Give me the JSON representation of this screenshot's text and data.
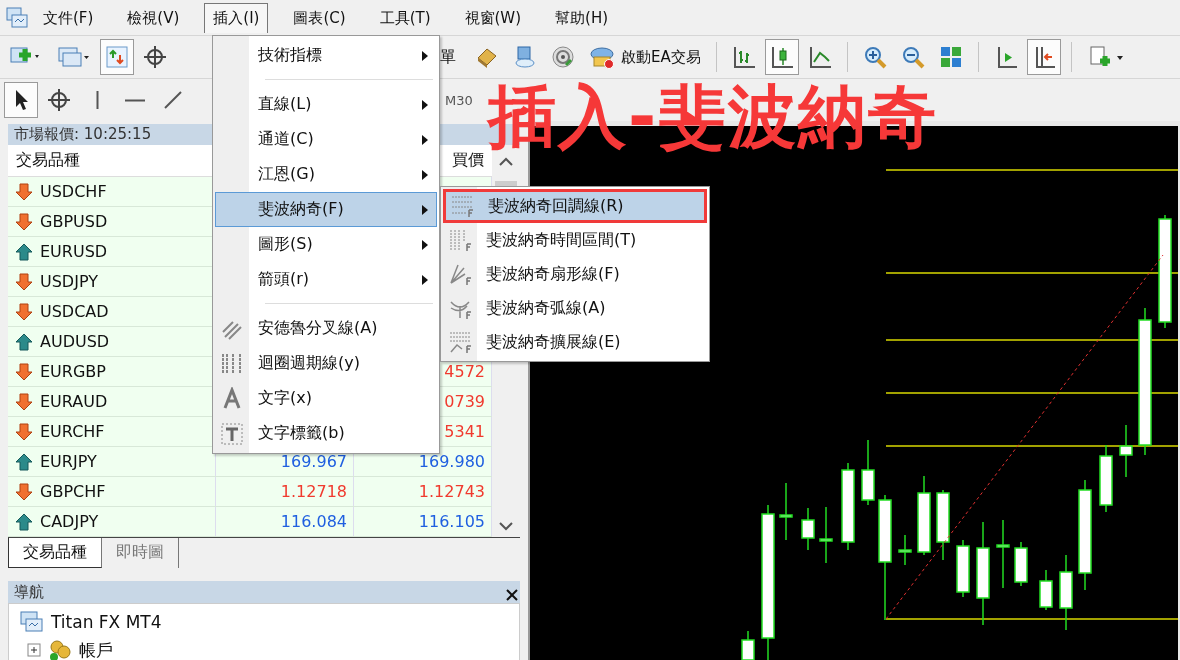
{
  "menu_bar": [
    {
      "label": "文件(F)",
      "selected": false
    },
    {
      "label": "檢視(V)",
      "selected": false
    },
    {
      "label": "插入(I)",
      "selected": true
    },
    {
      "label": "圖表(C)",
      "selected": false
    },
    {
      "label": "工具(T)",
      "selected": false
    },
    {
      "label": "視窗(W)",
      "selected": false
    },
    {
      "label": "幫助(H)",
      "selected": false
    }
  ],
  "toolbar": {
    "left": [
      {
        "kind": "new-chart"
      },
      {
        "kind": "profiles"
      },
      {
        "kind": "market-watch",
        "selected": true
      },
      {
        "kind": "crosshair"
      }
    ],
    "right": [
      {
        "kind": "text",
        "label": "單"
      },
      {
        "kind": "book"
      },
      {
        "kind": "terminal"
      },
      {
        "kind": "signals"
      },
      {
        "kind": "ea",
        "label": "啟動EA交易"
      },
      {
        "kind": "sep"
      },
      {
        "kind": "bars"
      },
      {
        "kind": "candles",
        "selected": true
      },
      {
        "kind": "line"
      },
      {
        "kind": "sep"
      },
      {
        "kind": "zoom-in"
      },
      {
        "kind": "zoom-out"
      },
      {
        "kind": "tile"
      },
      {
        "kind": "sep"
      },
      {
        "kind": "shift"
      },
      {
        "kind": "autoscroll",
        "selected": true
      },
      {
        "kind": "sep"
      },
      {
        "kind": "template"
      }
    ]
  },
  "drawing_toolbar": {
    "tools": [
      {
        "kind": "cursor",
        "selected": true
      },
      {
        "kind": "crosshair"
      },
      {
        "kind": "vline"
      },
      {
        "kind": "hline"
      },
      {
        "kind": "trendline"
      }
    ],
    "timeframes": [
      {
        "label": "M30",
        "selected": false
      }
    ]
  },
  "annotation": "插入-斐波納奇",
  "market_watch": {
    "title": "市場報價: 10:25:15",
    "columns": [
      "交易品種",
      "買價"
    ],
    "rows": [
      {
        "symbol": "USDCHF",
        "rising": false
      },
      {
        "symbol": "GBPUSD",
        "rising": false
      },
      {
        "symbol": "EURUSD",
        "rising": true
      },
      {
        "symbol": "USDJPY",
        "rising": false
      },
      {
        "symbol": "USDCAD",
        "rising": false
      },
      {
        "symbol": "AUDUSD",
        "rising": true
      },
      {
        "symbol": "EURGBP",
        "rising": false,
        "ask": "4572",
        "color": "#f03a2e"
      },
      {
        "symbol": "EURAUD",
        "rising": false,
        "ask": "0739",
        "color": "#f03a2e"
      },
      {
        "symbol": "EURCHF",
        "rising": false,
        "ask": "5341",
        "color": "#f03a2e"
      },
      {
        "symbol": "EURJPY",
        "rising": true,
        "bid": "169.967",
        "ask": "169.980",
        "color": "#1f5fe0"
      },
      {
        "symbol": "GBPCHF",
        "rising": false,
        "bid": "1.12718",
        "ask": "1.12743",
        "color": "#f03a2e"
      },
      {
        "symbol": "CADJPY",
        "rising": true,
        "bid": "116.084",
        "ask": "116.105",
        "color": "#1f5fe0"
      }
    ],
    "tabs": [
      {
        "label": "交易品種",
        "selected": true
      },
      {
        "label": "即時圖",
        "selected": false
      }
    ]
  },
  "navigator": {
    "title": "導航",
    "tree": [
      {
        "label": "Titan FX MT4",
        "kind": "terminal",
        "children": [
          {
            "label": "帳戶",
            "kind": "accounts",
            "expanded": false
          }
        ]
      }
    ]
  },
  "insert_menu": [
    {
      "kind": "submenu",
      "label": "技術指標",
      "selected": false
    },
    {
      "kind": "separator"
    },
    {
      "kind": "submenu",
      "label": "直線(L)",
      "selected": false
    },
    {
      "kind": "submenu",
      "label": "通道(C)",
      "selected": false
    },
    {
      "kind": "submenu",
      "label": "江恩(G)",
      "selected": false
    },
    {
      "kind": "submenu",
      "label": "斐波納奇(F)",
      "selected": true
    },
    {
      "kind": "submenu",
      "label": "圖形(S)",
      "selected": false
    },
    {
      "kind": "submenu",
      "label": "箭頭(r)",
      "selected": false
    },
    {
      "kind": "separator"
    },
    {
      "kind": "andrews",
      "label": "安德魯分叉線(A)",
      "selected": false
    },
    {
      "kind": "cycles",
      "label": "迴圈週期線(y)",
      "selected": false
    },
    {
      "kind": "text",
      "label": "文字(x)",
      "selected": false
    },
    {
      "kind": "label",
      "label": "文字標籤(b)",
      "selected": false
    }
  ],
  "fibonacci_menu": [
    {
      "kind": "retracement",
      "label": "斐波納奇回調線(R)",
      "selected": true,
      "annotated": true
    },
    {
      "kind": "timezones",
      "label": "斐波納奇時間區間(T)",
      "selected": false,
      "annotated": false
    },
    {
      "kind": "fan",
      "label": "斐波納奇扇形線(F)",
      "selected": false,
      "annotated": false
    },
    {
      "kind": "arcs",
      "label": "斐波納奇弧線(A)",
      "selected": false,
      "annotated": false
    },
    {
      "kind": "expansion",
      "label": "斐波納奇擴展線(E)",
      "selected": false,
      "annotated": false
    }
  ]
}
